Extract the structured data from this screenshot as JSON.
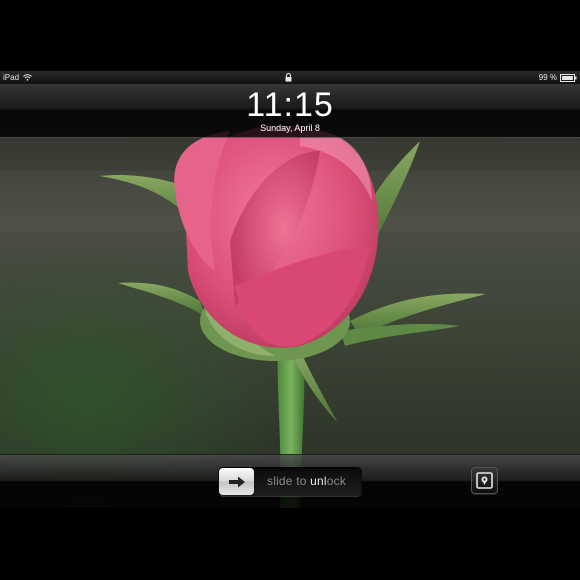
{
  "status_bar": {
    "device_name": "iPad",
    "battery_percent": "99 %",
    "battery_level": 0.99
  },
  "lock_screen": {
    "time": "11:15",
    "date": "Sunday, April 8"
  },
  "unlock_slider": {
    "text_before": "slide to ",
    "text_highlight": "unl",
    "text_after": "ock"
  },
  "icons": {
    "wifi": "wifi-icon",
    "lock": "lock-icon",
    "battery": "battery-icon",
    "arrow": "arrow-right-icon",
    "picture_frame": "picture-frame-icon"
  },
  "colors": {
    "rose_pink": "#e0577f",
    "background_green": "#3d4a34"
  }
}
